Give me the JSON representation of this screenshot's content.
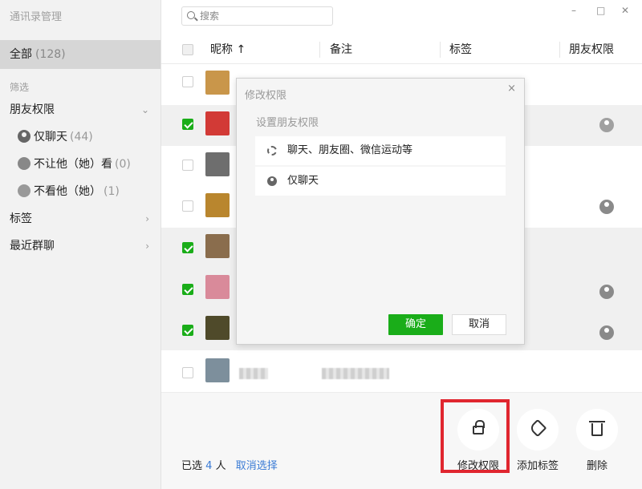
{
  "window": {
    "title": "通讯录管理",
    "controls": {
      "minimize": "–",
      "maximize": "□",
      "close": "✕"
    }
  },
  "sidebar": {
    "all_label": "全部",
    "all_count": "(128)",
    "filter_label": "筛选",
    "friend_perm_label": "朋友权限",
    "sub_items": [
      {
        "label": "仅聊天",
        "count": "(44)",
        "icon": "person-icon"
      },
      {
        "label": "不让他（她）看",
        "count": "(0)",
        "icon": "lock-person-icon"
      },
      {
        "label": "不看他（她）",
        "count": "(1)",
        "icon": "eye-hidden-icon"
      }
    ],
    "tags_label": "标签",
    "recent_groups_label": "最近群聊"
  },
  "search": {
    "placeholder": "搜索"
  },
  "table": {
    "columns": {
      "nickname": "昵称 ↑",
      "remark": "备注",
      "tag": "标签",
      "permission": "朋友权限"
    },
    "rows": [
      {
        "checked": false,
        "avatar_color": "#c9964a",
        "perm_icon": ""
      },
      {
        "checked": true,
        "avatar_color": "#d23a36",
        "perm_icon": "eye-hidden-icon"
      },
      {
        "checked": false,
        "avatar_color": "#6e6e6e",
        "perm_icon": ""
      },
      {
        "checked": false,
        "avatar_color": "#b9862e",
        "perm_icon": "person-icon"
      },
      {
        "checked": true,
        "avatar_color": "#8a6d4d",
        "perm_icon": ""
      },
      {
        "checked": true,
        "avatar_color": "#d98a9a",
        "perm_icon": "person-icon"
      },
      {
        "checked": true,
        "avatar_color": "#4f4a2a",
        "perm_icon": "person-icon"
      },
      {
        "checked": false,
        "avatar_color": "#7d8f9c",
        "perm_icon": ""
      }
    ]
  },
  "dialog": {
    "title": "修改权限",
    "close": "×",
    "subtitle": "设置朋友权限",
    "options": [
      {
        "label": "聊天、朋友圈、微信运动等",
        "icon": "loading-dash-icon"
      },
      {
        "label": "仅聊天",
        "icon": "person-icon"
      }
    ],
    "confirm": "确定",
    "cancel": "取消"
  },
  "bottom": {
    "selected_prefix": "已选",
    "selected_count": "4",
    "selected_suffix": "人",
    "cancel_selection": "取消选择",
    "actions": [
      {
        "label": "修改权限",
        "icon": "lock-icon"
      },
      {
        "label": "添加标签",
        "icon": "tag-icon"
      },
      {
        "label": "删除",
        "icon": "trash-icon"
      }
    ]
  },
  "colors": {
    "accent_green": "#1aad19",
    "highlight_red": "#e0262f",
    "link_blue": "#3a7bd5"
  }
}
